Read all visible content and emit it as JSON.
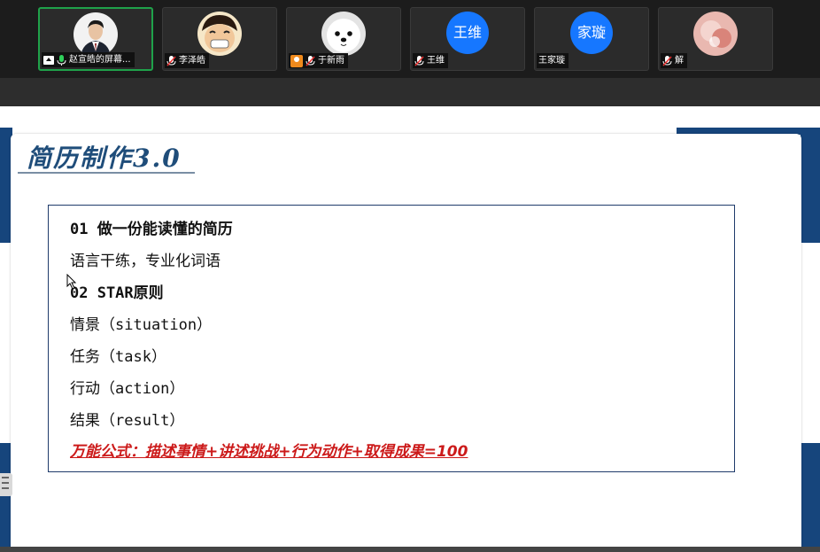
{
  "participants": [
    {
      "name": "赵宣皓的屏幕...",
      "avatar": "photo-man",
      "icons": [
        "share-screen-icon",
        "mic-active-icon"
      ],
      "active": true
    },
    {
      "name": "李泽皓",
      "avatar": "cartoon-luffy",
      "icons": [
        "mic-muted-icon"
      ]
    },
    {
      "name": "于新雨",
      "avatar": "dog-photo",
      "icons": [
        "camera-icon",
        "mic-muted-icon"
      ]
    },
    {
      "name": "王维",
      "avatar_text": "王维",
      "icons": [
        "mic-muted-icon"
      ]
    },
    {
      "name": "王家璇",
      "avatar_text": "家璇",
      "icons": []
    },
    {
      "name": "解",
      "avatar": "pink-photo",
      "icons": [
        "mic-muted-icon"
      ]
    }
  ],
  "slide": {
    "title": "简历制作3.0",
    "lines": [
      "01 做一份能读懂的简历",
      "语言干练，专业化词语",
      "02 STAR原则",
      "情景（situation）",
      "任务（task）",
      "行动（action）",
      "结果（result）"
    ],
    "formula": "万能公式：描述事情+讲述挑战+行为动作+取得成果=100"
  },
  "colors": {
    "accent_blue": "#16457c",
    "active_border": "#1fa24a",
    "avatar_blue": "#1677ff",
    "formula_red": "#cc1a1a"
  }
}
